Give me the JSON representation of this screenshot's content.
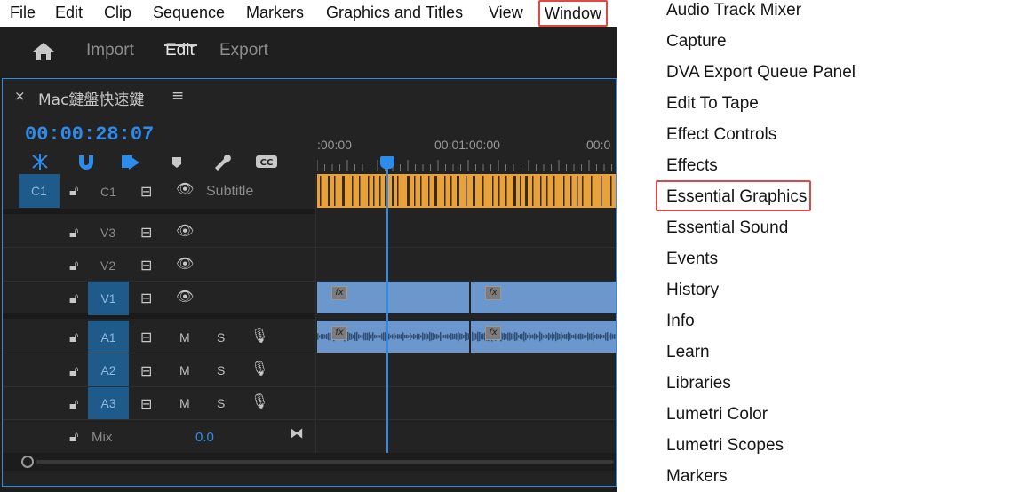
{
  "menubar": {
    "items": [
      "File",
      "Edit",
      "Clip",
      "Sequence",
      "Markers",
      "Graphics and Titles",
      "View",
      "Window"
    ]
  },
  "workspace": {
    "home": "home-icon",
    "tabs": [
      "Import",
      "Edit",
      "Export"
    ],
    "active": "Edit"
  },
  "timeline": {
    "close": "×",
    "sequence_name": "Mac鍵盤快速鍵",
    "menu": "≡",
    "timecode": "00:00:28:07",
    "ruler": [
      ":00:00",
      "00:01:00:00",
      "00:0"
    ],
    "playhead_fraction": 0.235,
    "tracks": {
      "c1": {
        "target": "C1",
        "name": "C1",
        "label": "Subtitle"
      },
      "v3": {
        "name": "V3"
      },
      "v2": {
        "name": "V2"
      },
      "v1": {
        "target": "V1"
      },
      "a1": {
        "target": "A1",
        "m": "M",
        "s": "S"
      },
      "a2": {
        "target": "A2",
        "m": "M",
        "s": "S"
      },
      "a3": {
        "target": "A3",
        "m": "M",
        "s": "S"
      },
      "mix": {
        "label": "Mix",
        "value": "0.0"
      }
    },
    "fx_label": "fx",
    "colors": {
      "accent": "#2d8ceb",
      "subtitle_clip": "#e8a23c",
      "video_clip": "#6b97cc",
      "highlight": "#e04848"
    }
  },
  "window_menu": {
    "items": [
      "Audio Track Mixer",
      "Capture",
      "DVA Export Queue Panel",
      "Edit To Tape",
      "Effect Controls",
      "Effects",
      "Essential Graphics",
      "Essential Sound",
      "Events",
      "History",
      "Info",
      "Learn",
      "Libraries",
      "Lumetri Color",
      "Lumetri Scopes",
      "Markers"
    ],
    "highlighted": "Essential Graphics"
  }
}
